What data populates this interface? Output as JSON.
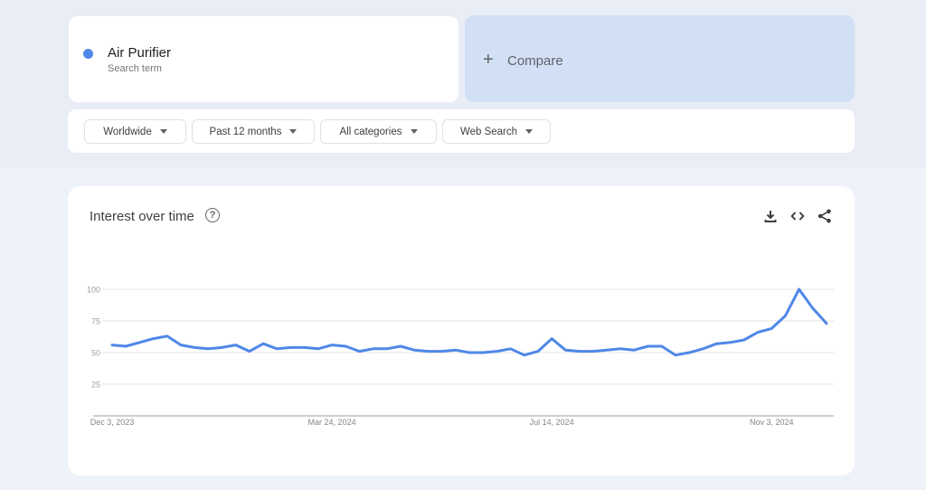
{
  "search_term": {
    "label": "Air Purifier",
    "sublabel": "Search term",
    "color": "#4f88e8"
  },
  "compare": {
    "icon": "plus-icon",
    "label": "Compare"
  },
  "filters": [
    {
      "label": "Worldwide"
    },
    {
      "label": "Past 12 months"
    },
    {
      "label": "All categories"
    },
    {
      "label": "Web Search"
    }
  ],
  "panel": {
    "title": "Interest over time",
    "help_icon": "?",
    "actions": [
      "download-icon",
      "embed-code-icon",
      "share-icon"
    ]
  },
  "chart_data": {
    "type": "line",
    "title": "Interest over time",
    "xlabel": "",
    "ylabel": "",
    "ylim": [
      0,
      100
    ],
    "yticks": [
      25,
      50,
      75,
      100
    ],
    "ytick_labels": [
      "25",
      "50",
      "75",
      "100"
    ],
    "xtick_labels": [
      {
        "label": "Dec 3, 2023",
        "index": 0
      },
      {
        "label": "Mar 24, 2024",
        "index": 16
      },
      {
        "label": "Jul 14, 2024",
        "index": 32
      },
      {
        "label": "Nov 3, 2024",
        "index": 48
      }
    ],
    "grid": true,
    "legend": "none",
    "series": [
      {
        "name": "Air Purifier",
        "color": "#4f88e8",
        "values": [
          56,
          55,
          58,
          61,
          63,
          56,
          54,
          53,
          54,
          56,
          51,
          57,
          53,
          54,
          54,
          53,
          56,
          55,
          51,
          53,
          53,
          55,
          52,
          51,
          51,
          52,
          50,
          50,
          51,
          53,
          48,
          51,
          61,
          52,
          51,
          51,
          52,
          53,
          52,
          55,
          55,
          48,
          50,
          53,
          57,
          58,
          60,
          66,
          69,
          79,
          100,
          85,
          73
        ]
      }
    ]
  }
}
